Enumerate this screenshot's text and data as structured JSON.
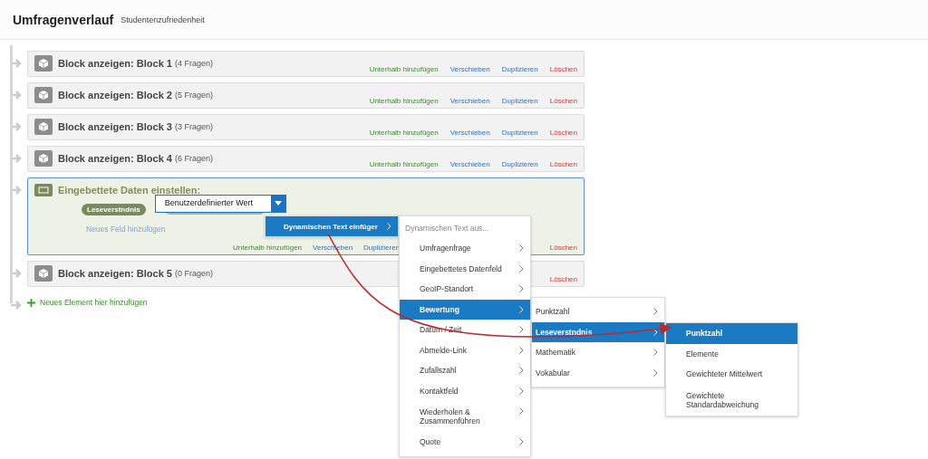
{
  "header": {
    "title": "Umfragenverlauf",
    "subtitle": "Studentenzufriedenheit"
  },
  "flow": [
    {
      "kind": "block",
      "title": "Block anzeigen: Block 1",
      "count": "(4 Fragen)",
      "actions": [
        {
          "kind": "add",
          "label": "Unterhalb hinzufügen"
        },
        {
          "kind": "move",
          "label": "Verschieben"
        },
        {
          "kind": "copy",
          "label": "Duplizieren"
        },
        {
          "kind": "delete",
          "label": "Löschen"
        }
      ]
    },
    {
      "kind": "block",
      "title": "Block anzeigen: Block 2",
      "count": "(5 Fragen)",
      "actions": [
        {
          "kind": "add",
          "label": "Unterhalb hinzufügen"
        },
        {
          "kind": "move",
          "label": "Verschieben"
        },
        {
          "kind": "copy",
          "label": "Duplizieren"
        },
        {
          "kind": "delete",
          "label": "Löschen"
        }
      ]
    },
    {
      "kind": "block",
      "title": "Block anzeigen: Block 3",
      "count": "(3 Fragen)",
      "actions": [
        {
          "kind": "add",
          "label": "Unterhalb hinzufügen"
        },
        {
          "kind": "move",
          "label": "Verschieben"
        },
        {
          "kind": "copy",
          "label": "Duplizieren"
        },
        {
          "kind": "delete",
          "label": "Löschen"
        }
      ]
    },
    {
      "kind": "block",
      "title": "Block anzeigen: Block 4",
      "count": "(6 Fragen)",
      "actions": [
        {
          "kind": "add",
          "label": "Unterhalb hinzufügen"
        },
        {
          "kind": "move",
          "label": "Verschieben"
        },
        {
          "kind": "copy",
          "label": "Duplizieren"
        },
        {
          "kind": "delete",
          "label": "Löschen"
        }
      ]
    },
    {
      "kind": "embedded",
      "title": "Eingebettete Daten einstellen:",
      "field": "Leseverstndnis",
      "value": "Benutzerdefinierter Wert",
      "add_field": "Neues Feld hinzufügen",
      "actions": [
        {
          "kind": "add",
          "label": "Unterhalb hinzufügen"
        },
        {
          "kind": "move",
          "label": "Verschieben"
        },
        {
          "kind": "copy",
          "label": "Duplizieren"
        },
        {
          "kind": "delete",
          "label": "Löschen"
        }
      ]
    },
    {
      "kind": "block",
      "title": "Block anzeigen: Block 5",
      "count": "(0 Fragen)",
      "actions": [
        {
          "kind": "delete",
          "label": "Löschen"
        }
      ]
    }
  ],
  "add_element": "Neues Element hier hinzufügen",
  "menus": [
    {
      "items": [
        {
          "label": "Dynamischen Text einfüger",
          "submenu": true,
          "selected": true
        }
      ]
    },
    {
      "heading": "Dynamischen Text aus...",
      "items": [
        {
          "label": "Umfragenfrage",
          "submenu": true,
          "selected": false
        },
        {
          "label": "Eingebettetes Datenfeld",
          "submenu": true,
          "selected": false
        },
        {
          "label": "GeoIP-Standort",
          "submenu": true,
          "selected": false
        },
        {
          "label": "Bewertung",
          "submenu": true,
          "selected": true
        },
        {
          "label": "Datum / Zeit",
          "submenu": true,
          "selected": false
        },
        {
          "label": "Abmelde-Link",
          "submenu": true,
          "selected": false
        },
        {
          "label": "Zufallszahl",
          "submenu": true,
          "selected": false
        },
        {
          "label": "Kontaktfeld",
          "submenu": true,
          "selected": false
        },
        {
          "label": "Wiederholen & Zusammenführen",
          "submenu": true,
          "selected": false
        },
        {
          "label": "Quote",
          "submenu": true,
          "selected": false
        }
      ]
    },
    {
      "items": [
        {
          "label": "Punktzahl",
          "submenu": true,
          "selected": false
        },
        {
          "label": "Leseverstndnis",
          "submenu": true,
          "selected": true
        },
        {
          "label": "Mathematik",
          "submenu": true,
          "selected": false
        },
        {
          "label": "Vokabular",
          "submenu": true,
          "selected": false
        }
      ]
    },
    {
      "items": [
        {
          "label": "Punktzahl",
          "submenu": false,
          "selected": true
        },
        {
          "label": "Elemente",
          "submenu": false,
          "selected": false
        },
        {
          "label": "Gewichteter Mittelwert",
          "submenu": false,
          "selected": false
        },
        {
          "label": "Gewichtete Standardabweichung",
          "submenu": false,
          "selected": false
        }
      ]
    }
  ]
}
